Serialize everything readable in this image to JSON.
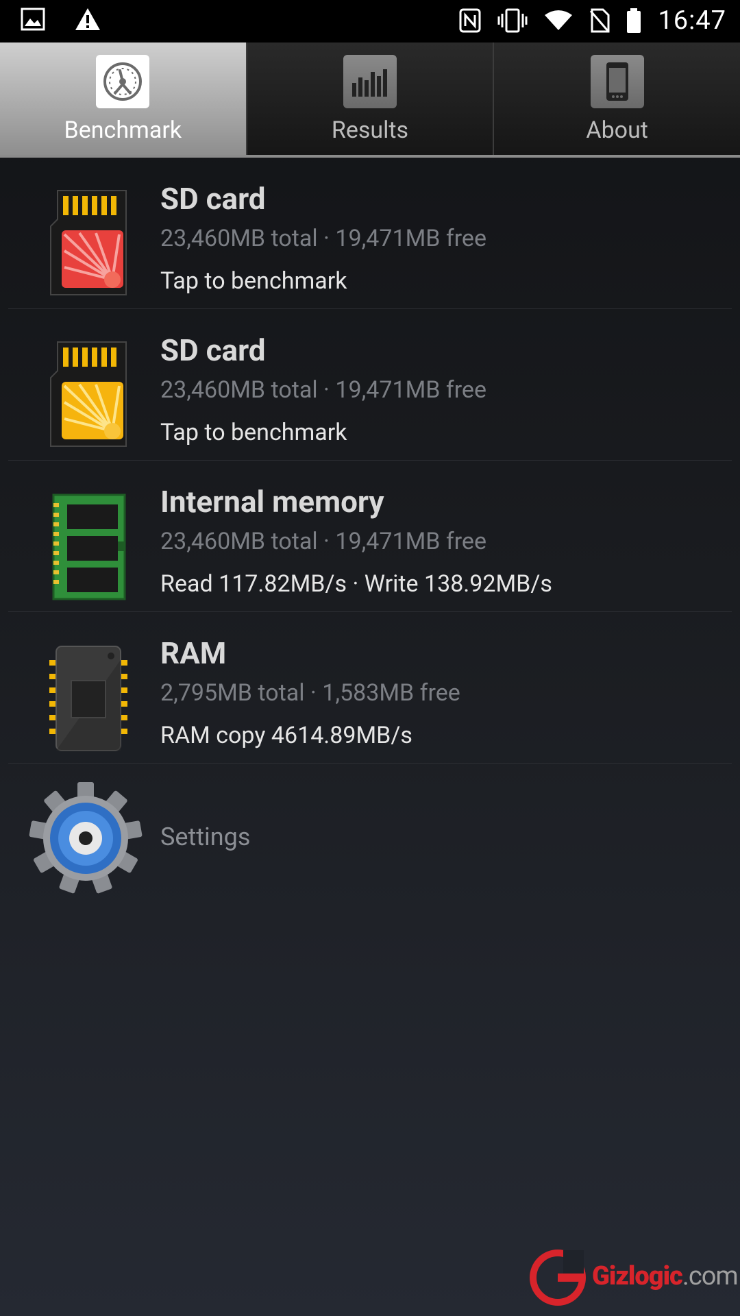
{
  "status_bar": {
    "time": "16:47",
    "left_icons": [
      "image-icon",
      "warning-icon"
    ],
    "right_icons": [
      "nfc-icon",
      "vibrate-icon",
      "wifi-icon",
      "no-sim-icon",
      "battery-icon"
    ]
  },
  "tabs": [
    {
      "label": "Benchmark",
      "icon": "speedometer-icon",
      "active": true
    },
    {
      "label": "Results",
      "icon": "bar-chart-icon",
      "active": false
    },
    {
      "label": "About",
      "icon": "phone-icon",
      "active": false
    }
  ],
  "items": [
    {
      "title": "SD card",
      "subtitle": "23,460MB total · 19,471MB free",
      "detail": "Tap to benchmark",
      "icon": "sd-card-red-icon"
    },
    {
      "title": "SD card",
      "subtitle": "23,460MB total · 19,471MB free",
      "detail": "Tap to benchmark",
      "icon": "sd-card-yellow-icon"
    },
    {
      "title": "Internal memory",
      "subtitle": "23,460MB total · 19,471MB free",
      "detail": "Read 117.82MB/s · Write 138.92MB/s",
      "icon": "memory-module-icon"
    },
    {
      "title": "RAM",
      "subtitle": "2,795MB total · 1,583MB free",
      "detail": "RAM copy 4614.89MB/s",
      "icon": "ram-chip-icon"
    }
  ],
  "settings": {
    "label": "Settings",
    "icon": "settings-gear-icon"
  },
  "watermark": {
    "brand": "Gizlogic",
    "suffix": ".com"
  },
  "colors": {
    "active_tab": "#bdbdbd",
    "watermark_red": "#d8242b"
  }
}
